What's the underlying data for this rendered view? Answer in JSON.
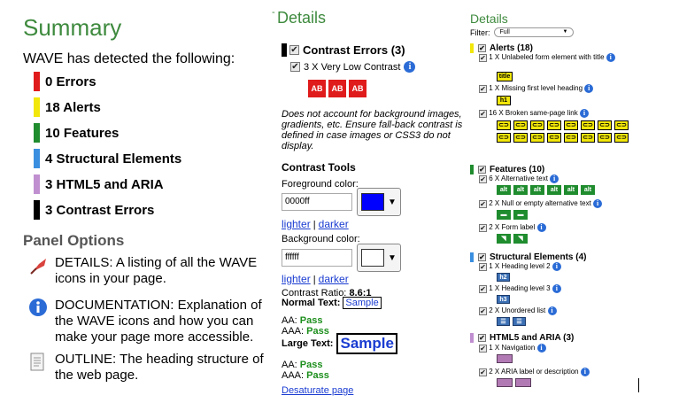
{
  "summary": {
    "title": "Summary",
    "intro": "WAVE has detected the following:",
    "rows": [
      {
        "label": "0 Errors",
        "color": "#e01b1b"
      },
      {
        "label": "18 Alerts",
        "color": "#f2e70a"
      },
      {
        "label": "10 Features",
        "color": "#1f8c2e"
      },
      {
        "label": "4 Structural Elements",
        "color": "#3b8fe0"
      },
      {
        "label": "3 HTML5 and ARIA",
        "color": "#c08fd0"
      },
      {
        "label": "3 Contrast Errors",
        "color": "#000000"
      }
    ]
  },
  "panel_options": {
    "title": "Panel Options",
    "items": [
      {
        "text": "DETAILS: A listing of all the WAVE icons in your page.",
        "icon": "flag-icon"
      },
      {
        "text": "DOCUMENTATION: Explanation of the WAVE icons and how you can make your page more accessible.",
        "icon": "info-icon"
      },
      {
        "text": "OUTLINE: The heading structure of the web page.",
        "icon": "document-icon"
      }
    ]
  },
  "details_mid": {
    "title": "Details",
    "dash": "-",
    "contrast_errors": "Contrast Errors (3)",
    "very_low_contrast": "3 X Very Low Contrast",
    "icon_text": "AB",
    "note": "Does not account for background images, gradients, etc. Ensure fall-back contrast is defined in case images or CSS3 do not display.",
    "contrast_tools": "Contrast Tools",
    "fg_label": "Foreground color:",
    "fg_value": "0000ff",
    "fg_color": "#0000ff",
    "lighter": "lighter",
    "sep": "|",
    "darker": "darker",
    "bg_label": "Background color:",
    "bg_value": "ffffff",
    "bg_color": "#ffffff",
    "ratio_label": "Contrast Ratio:",
    "ratio_value": "8.6:1",
    "normal_text": "Normal Text:",
    "sample": "Sample",
    "aa_label": "AA:",
    "aaa_label": "AAA:",
    "pass": "Pass",
    "large_text": "Large Text:",
    "desaturate": "Desaturate page"
  },
  "details_right": {
    "title": "Details",
    "filter_label": "Filter:",
    "filter_value": "Full",
    "alerts": "Alerts (18)",
    "unlabeled": "1 X Unlabeled form element with title",
    "title_icon": "title",
    "missing_h1": "1 X Missing first level heading",
    "h1_icon": "h1",
    "broken_link": "16 X Broken same-page link",
    "features": "Features (10)",
    "alt_text": "6 X Alternative text",
    "alt_icon": "alt",
    "null_alt": "2 X Null or empty alternative text",
    "form_label": "2 X Form label",
    "structural": "Structural Elements (4)",
    "h2": "1 X Heading level 2",
    "h2_icon": "h2",
    "h3": "1 X Heading level 3",
    "h3_icon": "h3",
    "ul": "2 X Unordered list",
    "html5": "HTML5 and ARIA (3)",
    "nav": "1 X Navigation",
    "aria": "2 X ARIA label or description"
  }
}
